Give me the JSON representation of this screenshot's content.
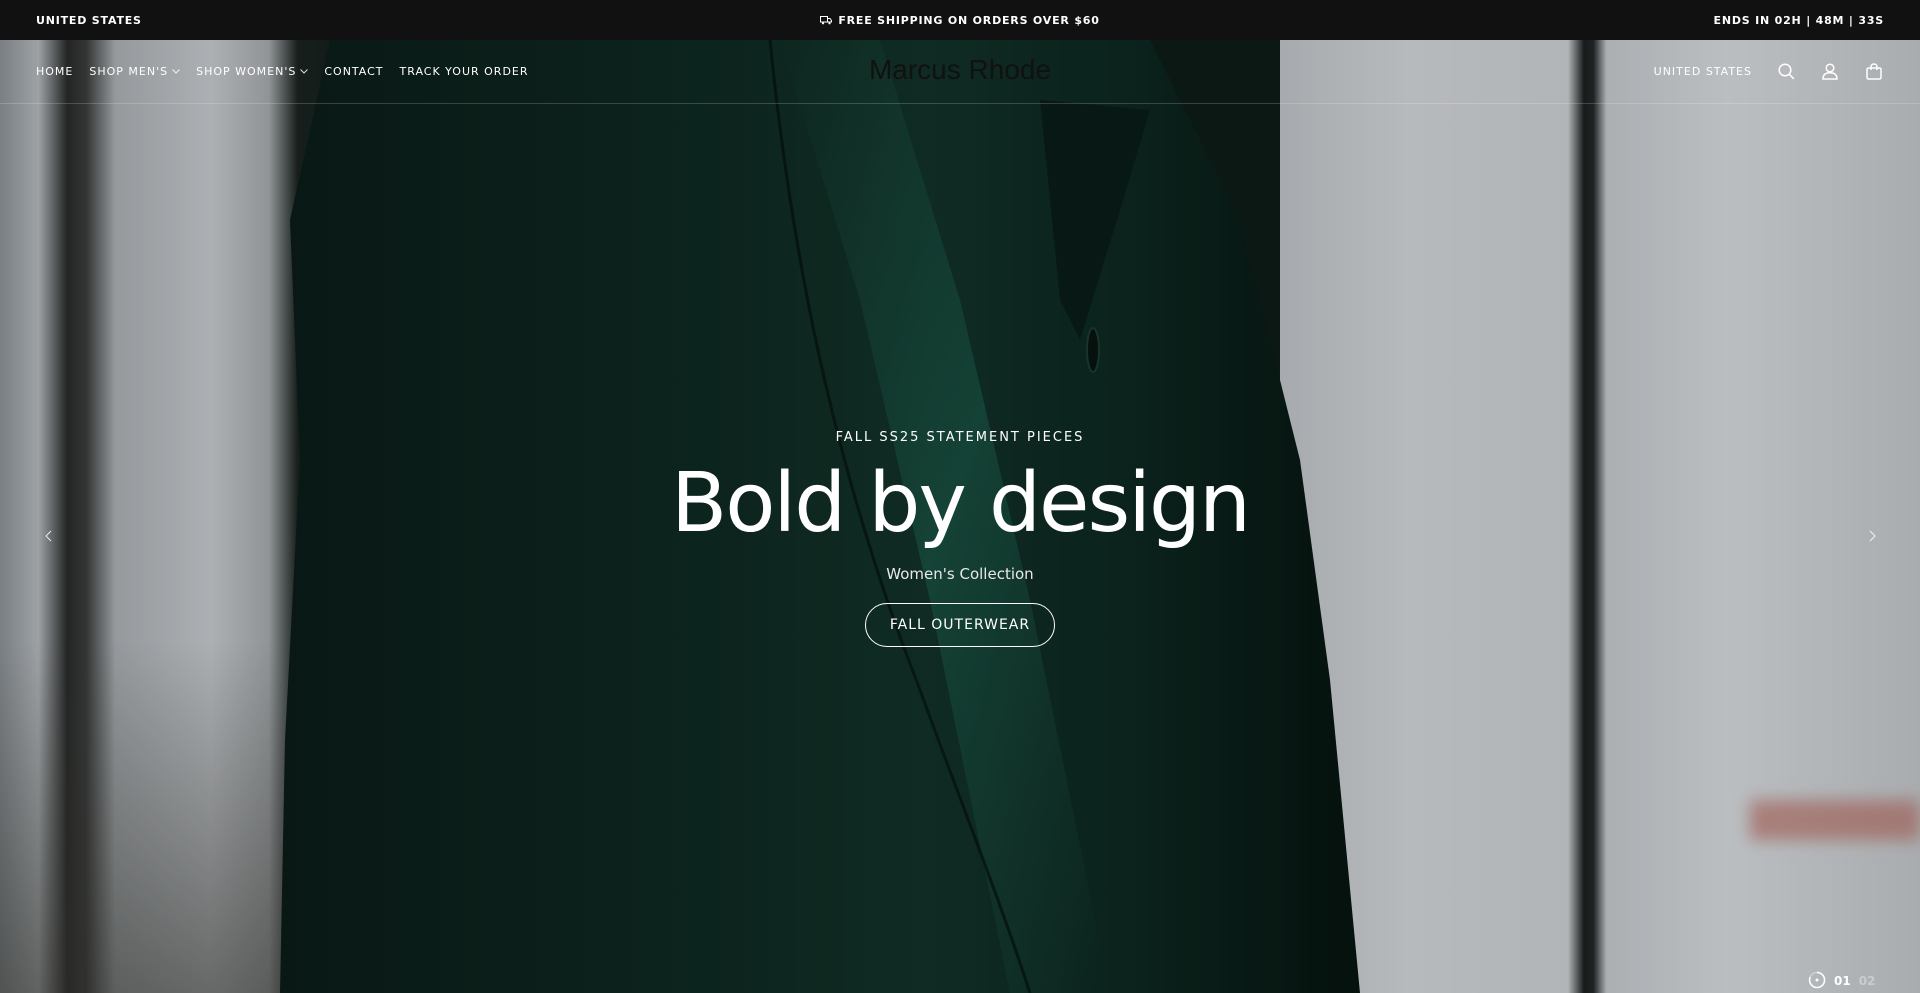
{
  "announcement": {
    "left_text": "UNITED STATES",
    "center_text": "FREE SHIPPING ON ORDERS OVER $60",
    "right_text": "ENDS IN 02H | 48M | 33S"
  },
  "header": {
    "logo": "Marcus Rhode",
    "nav": [
      {
        "label": "HOME",
        "has_dropdown": false
      },
      {
        "label": "SHOP MEN'S",
        "has_dropdown": true
      },
      {
        "label": "SHOP WOMEN'S",
        "has_dropdown": true
      },
      {
        "label": "CONTACT",
        "has_dropdown": false
      },
      {
        "label": "TRACK YOUR ORDER",
        "has_dropdown": false
      }
    ],
    "country": "UNITED STATES",
    "icons": [
      "search-icon",
      "account-icon",
      "cart-icon"
    ]
  },
  "hero": {
    "eyebrow": "FALL SS25 STATEMENT PIECES",
    "headline": "Bold by design",
    "subheadline": "Women's Collection",
    "cta_label": "FALL OUTERWEAR",
    "slides": {
      "current": "01",
      "next": "02"
    }
  },
  "colors": {
    "topbar_bg": "#111111",
    "text_on_hero": "#ffffff",
    "coat_green": "#0f2a24"
  }
}
